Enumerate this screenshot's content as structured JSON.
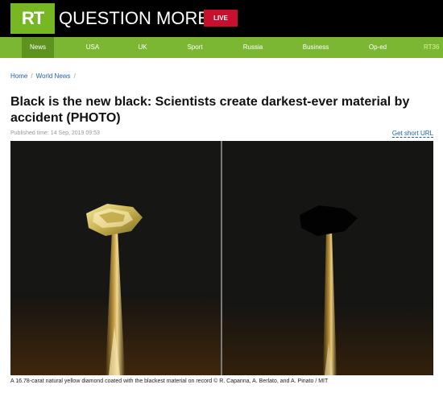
{
  "header": {
    "logo_text": "RT",
    "brand_text": "QUESTION MORE",
    "live_label": "LIVE"
  },
  "nav": {
    "items": [
      "News",
      "USA",
      "UK",
      "Sport",
      "Russia",
      "Business",
      "Op-ed",
      "RT36"
    ]
  },
  "breadcrumb": {
    "home": "Home",
    "section": "World News",
    "trailing": "/"
  },
  "article": {
    "title": "Black is the new black: Scientists create darkest-ever material by accident (PHOTO)",
    "published": "Published time: 14 Sep, 2019 09:53",
    "short_url_label": "Get short URL",
    "caption": "A 16.78-carat natural yellow diamond coated with the blackest material on record © R. Capanna, A. Berlato, and A. Pinato / MIT"
  },
  "colors": {
    "header_bg": "#000000",
    "logo_green": "#77b723",
    "nav_green": "#7cb733",
    "live_red": "#c8102e",
    "link_blue": "#1a62a8"
  }
}
